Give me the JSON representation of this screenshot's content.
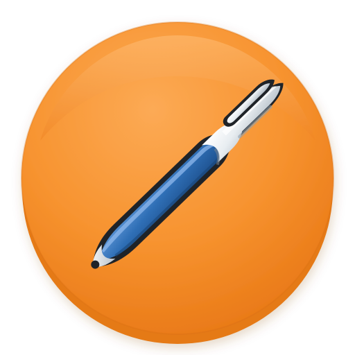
{
  "app_icon": {
    "icon_name": "pen-icon",
    "colors": {
      "background_orange": "#f7932f",
      "background_orange_light": "#fcaa55",
      "background_orange_dark": "#e87715",
      "pen_body_blue": "#2f6fb6",
      "pen_body_blue_light": "#5d95d6",
      "pen_body_blue_dark": "#1d4f8c",
      "pen_cap_silver": "#e8edf1",
      "pen_cap_silver_shadow": "#a8b3bd",
      "outline": "#1f2328"
    }
  }
}
